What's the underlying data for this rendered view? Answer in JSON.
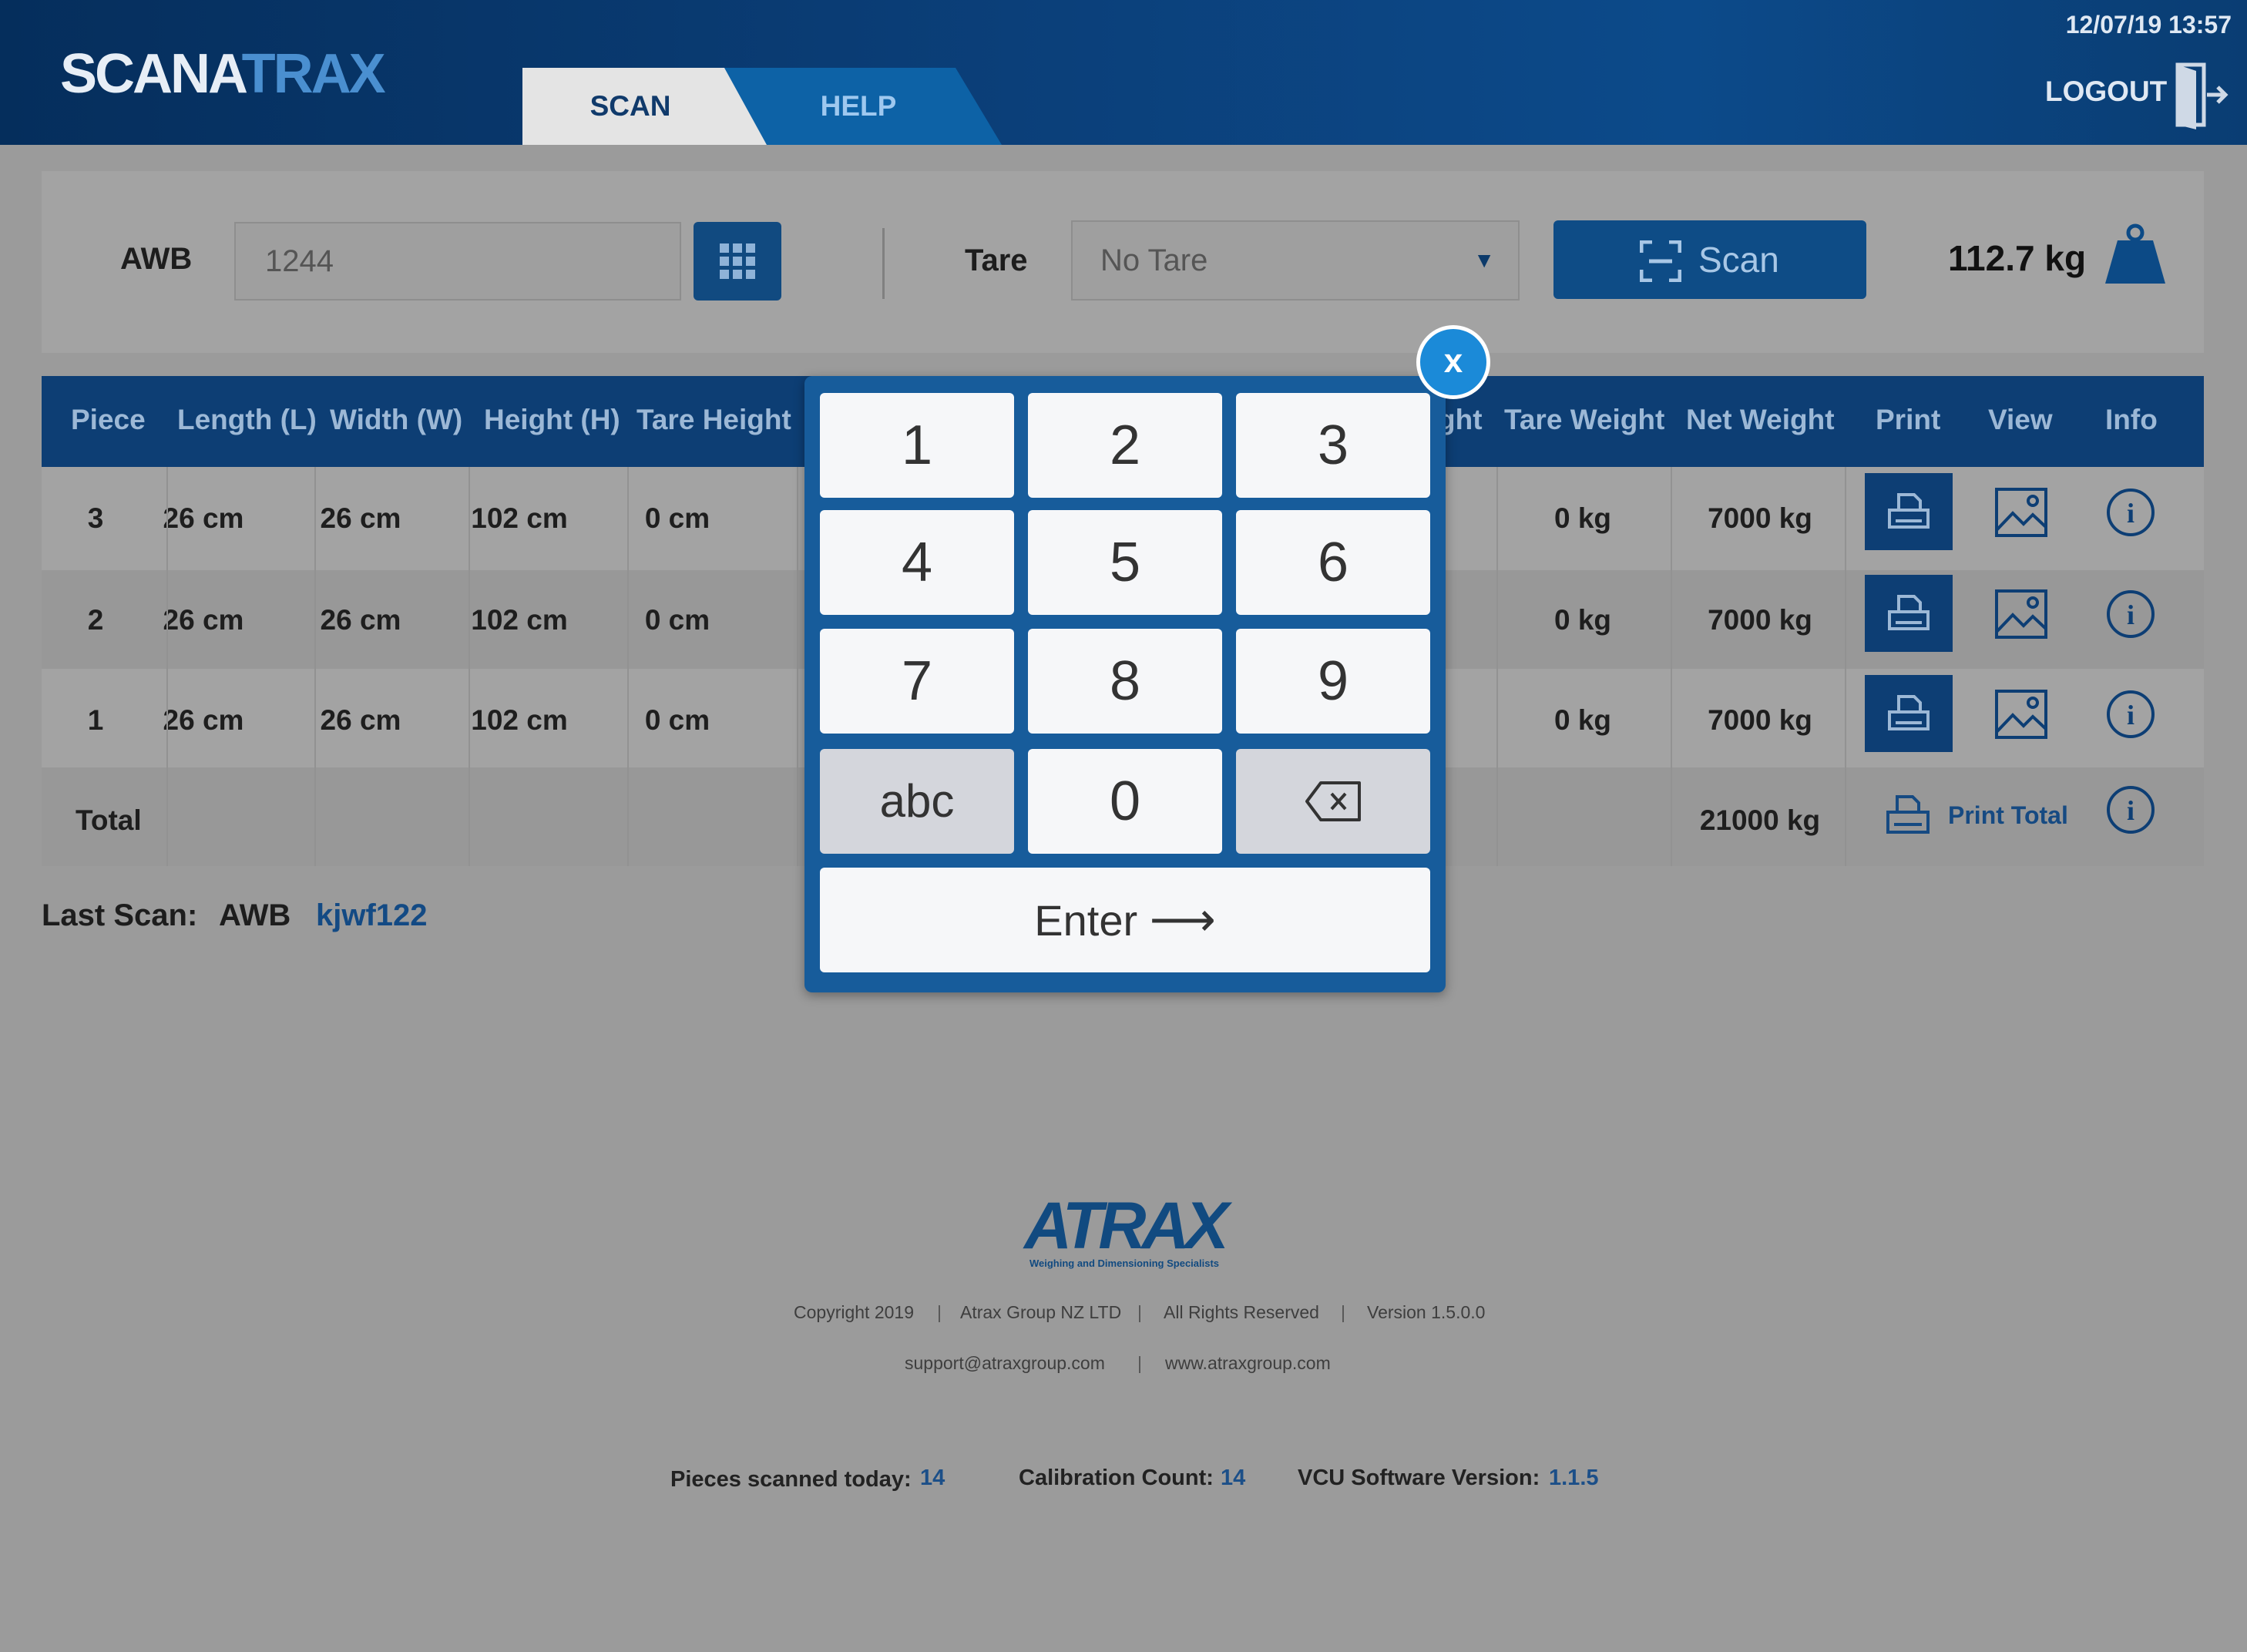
{
  "header": {
    "logo_part1": "SCANA",
    "logo_part2": "TRAX",
    "tabs": [
      {
        "label": "SCAN",
        "active": true
      },
      {
        "label": "HELP",
        "active": false
      }
    ],
    "datetime": "12/07/19 13:57",
    "logout_label": "LOGOUT",
    "logout_icon": "door-exit-icon"
  },
  "scanbar": {
    "awb_label": "AWB",
    "awb_value": "1244",
    "keypad_icon": "grid-keypad-icon",
    "tare_label": "Tare",
    "tare_value": "No Tare",
    "scan_label": "Scan",
    "scan_icon": "scan-frame-icon",
    "weight": "112.7 kg",
    "weight_icon": "weight-icon"
  },
  "table": {
    "headers": [
      "Piece",
      "Length (L)",
      "Width (W)",
      "Height (H)",
      "Tare Height",
      "ght",
      "Tare Weight",
      "Net Weight",
      "Print",
      "View",
      "Info"
    ],
    "rows": [
      {
        "piece": "3",
        "length": "26 cm",
        "width": "26 cm",
        "height": "102 cm",
        "tare_height": "0 cm",
        "tare_weight": "0 kg",
        "net_weight": "7000 kg"
      },
      {
        "piece": "2",
        "length": "26 cm",
        "width": "26 cm",
        "height": "102 cm",
        "tare_height": "0 cm",
        "tare_weight": "0 kg",
        "net_weight": "7000 kg"
      },
      {
        "piece": "1",
        "length": "26 cm",
        "width": "26 cm",
        "height": "102 cm",
        "tare_height": "0 cm",
        "tare_weight": "0 kg",
        "net_weight": "7000 kg"
      }
    ],
    "total_label": "Total",
    "total_net": "21000 kg",
    "print_total_label": "Print Total",
    "icons": {
      "print": "printer-icon",
      "view": "image-icon",
      "info": "info-icon"
    }
  },
  "last_scan": {
    "label": "Last Scan:",
    "awb_label": "AWB",
    "value": "kjwf122"
  },
  "footer": {
    "logo": "ATRAX",
    "tagline": "Weighing and Dimensioning Specialists",
    "copyright": "Copyright 2019",
    "company": "Atrax Group NZ LTD",
    "rights": "All Rights Reserved",
    "version": "Version 1.5.0.0",
    "email": "support@atraxgroup.com",
    "website": "www.atraxgroup.com",
    "separator": "|",
    "stats": {
      "pieces_label": "Pieces scanned today:",
      "pieces_value": "14",
      "calibration_label": "Calibration Count:",
      "calibration_value": "14",
      "vcu_label": "VCU Software Version:",
      "vcu_value": "1.1.5"
    }
  },
  "keypad": {
    "close_label": "x",
    "keys": [
      "1",
      "2",
      "3",
      "4",
      "5",
      "6",
      "7",
      "8",
      "9",
      "abc",
      "0"
    ],
    "backspace_icon": "backspace-icon",
    "enter_label": "Enter",
    "enter_arrow": "⟶"
  },
  "colors": {
    "header_bg": "#0b3f79",
    "accent": "#0d4c86",
    "keypad_bg": "#175c9b",
    "close_btn": "#1b8ad8",
    "link": "#134a84"
  }
}
